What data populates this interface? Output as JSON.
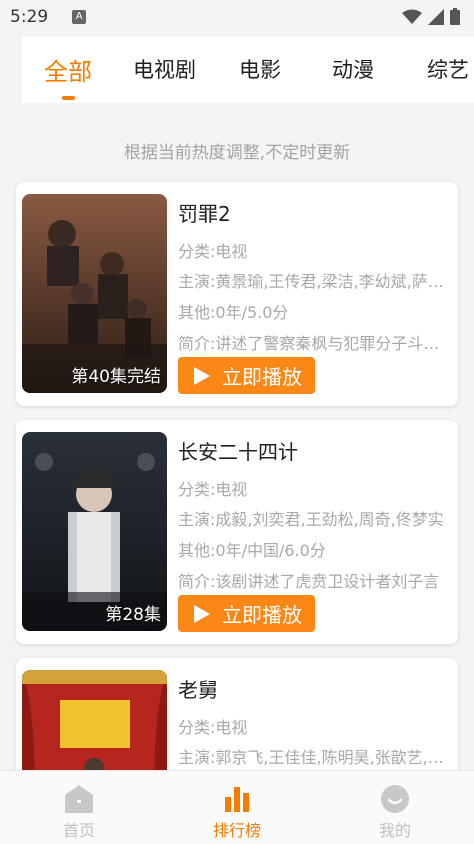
{
  "status_bar": {
    "time": "5:29",
    "notification_icon": "a-icon",
    "icons": [
      "wifi-icon",
      "signal-icon",
      "battery-icon"
    ]
  },
  "tabs": [
    {
      "label": "全部",
      "active": true
    },
    {
      "label": "电视剧",
      "active": false
    },
    {
      "label": "电影",
      "active": false
    },
    {
      "label": "动漫",
      "active": false
    },
    {
      "label": "综艺",
      "active": false
    }
  ],
  "notice": "根据当前热度调整,不定时更新",
  "accent_color": "#f57c00",
  "play_label": "立即播放",
  "items": [
    {
      "title": "罚罪2",
      "category": "分类:电视",
      "cast": "主演:黄景瑜,王传君,梁洁,李幼斌,萨日娜",
      "other": "其他:0年/5.0分",
      "intro": "简介:讲述了警察秦枫与犯罪分子斗智斗勇",
      "badge": "第40集完结"
    },
    {
      "title": "长安二十四计",
      "category": "分类:电视",
      "cast": "主演:成毅,刘奕君,王劲松,周奇,佟梦实",
      "other": "其他:0年/中国/6.0分",
      "intro": "简介:该剧讲述了虎贲卫设计者刘子言",
      "badge": "第28集"
    },
    {
      "title": "老舅",
      "category": "分类:电视",
      "cast": "主演:郭京飞,王佳佳,陈明昊,张歆艺,马丽",
      "other": "",
      "intro": "",
      "badge": ""
    }
  ],
  "bottom_nav": [
    {
      "label": "首页",
      "icon": "home-icon",
      "active": false
    },
    {
      "label": "排行榜",
      "icon": "ranking-bar-icon",
      "active": true
    },
    {
      "label": "我的",
      "icon": "profile-icon",
      "active": false
    }
  ]
}
